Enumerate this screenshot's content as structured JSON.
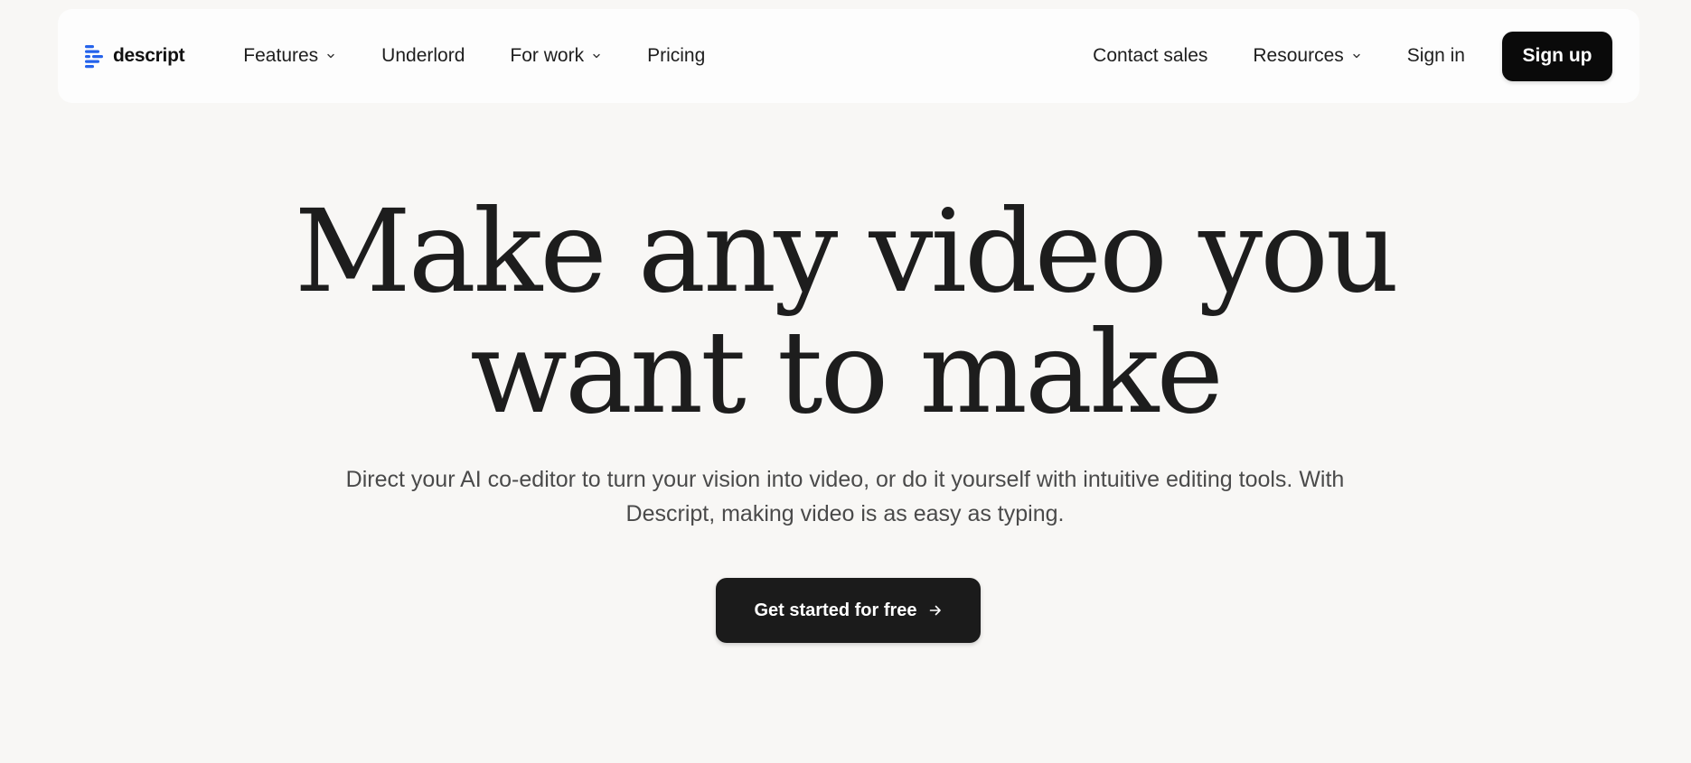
{
  "brand": {
    "name": "descript",
    "accent_color": "#2563eb"
  },
  "nav": {
    "left_items": [
      {
        "label": "Features",
        "has_dropdown": true
      },
      {
        "label": "Underlord",
        "has_dropdown": false
      },
      {
        "label": "For work",
        "has_dropdown": true
      },
      {
        "label": "Pricing",
        "has_dropdown": false
      }
    ],
    "right_items": [
      {
        "label": "Contact sales",
        "has_dropdown": false
      },
      {
        "label": "Resources",
        "has_dropdown": true
      },
      {
        "label": "Sign in",
        "has_dropdown": false
      }
    ],
    "signup_label": "Sign up"
  },
  "hero": {
    "title_line1": "Make any video you",
    "title_line2": "want to make",
    "subtitle": "Direct your AI co-editor to turn your vision into video, or do it yourself with intuitive editing tools. With Descript, making video is as easy as typing.",
    "cta_label": "Get started for free",
    "cta_icon": "arrow-right-icon"
  },
  "colors": {
    "background": "#f8f7f5",
    "nav_background": "#fdfdfd",
    "button_dark": "#0a0a0a"
  }
}
